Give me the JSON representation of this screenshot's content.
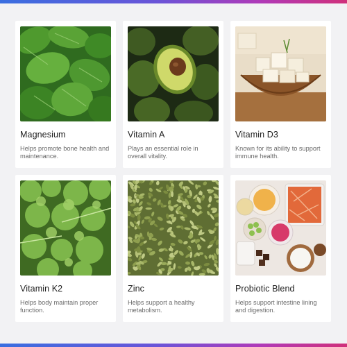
{
  "cards": [
    {
      "name": "Magnesium",
      "description": "Helps promote bone health and maintenance.",
      "image": "spinach-leaves-photo"
    },
    {
      "name": "Vitamin A",
      "description": "Plays an essential role in overall vitality.",
      "image": "avocados-photo"
    },
    {
      "name": "Vitamin D3",
      "description": "Known for its ability to support immune health.",
      "image": "tofu-bowl-photo"
    },
    {
      "name": "Vitamin K2",
      "description": "Helps body maintain proper function.",
      "image": "kale-photo"
    },
    {
      "name": "Zinc",
      "description": "Helps support a healthy metabolism.",
      "image": "pumpkin-seeds-photo"
    },
    {
      "name": "Probiotic Blend",
      "description": "Helps support intestine lining and digestion.",
      "image": "fermented-foods-photo"
    }
  ],
  "colors": {
    "background": "#f2f2f4",
    "card": "#ffffff",
    "title_text": "#1e1e1e",
    "body_text": "#6a6a6a",
    "gradient": [
      "#3a6fe0",
      "#6a55d8",
      "#b03ab8",
      "#d0307a"
    ]
  }
}
